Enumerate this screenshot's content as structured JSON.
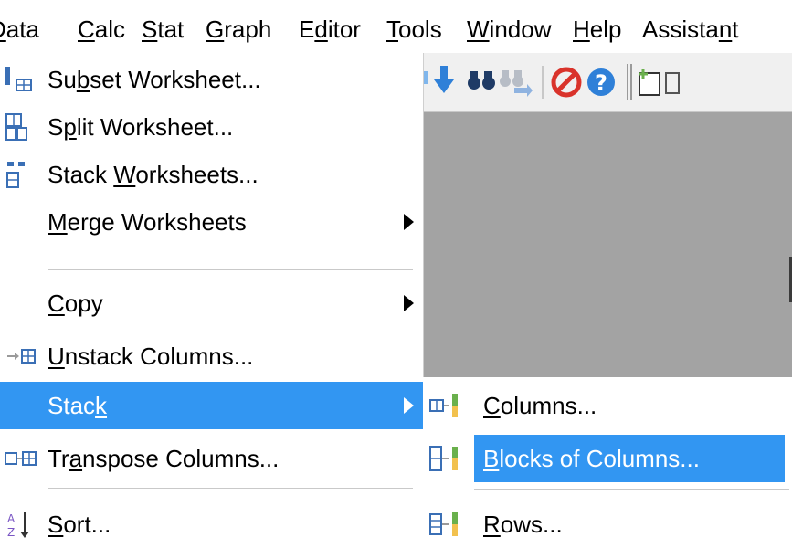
{
  "menubar": {
    "items": [
      {
        "label": "Data",
        "ul": "D"
      },
      {
        "label": "Calc",
        "ul": "C"
      },
      {
        "label": "Stat",
        "ul": "S"
      },
      {
        "label": "Graph",
        "ul": "G"
      },
      {
        "label": "Editor",
        "ul": "d"
      },
      {
        "label": "Tools",
        "ul": "T"
      },
      {
        "label": "Window",
        "ul": "W"
      },
      {
        "label": "Help",
        "ul": "H"
      },
      {
        "label": "Assistant",
        "ul": "n"
      }
    ]
  },
  "toolbar": {
    "icons": [
      "down-arrow-icon",
      "binoculars-icon",
      "find-next-icon",
      "stop-icon",
      "help-icon",
      "new-note-icon"
    ]
  },
  "data_menu": {
    "items": [
      {
        "label": "Subset Worksheet...",
        "ul": "b"
      },
      {
        "label": "Split Worksheet...",
        "ul": "p"
      },
      {
        "label": "Stack Worksheets...",
        "ul": "W"
      },
      {
        "label": "Merge Worksheets",
        "ul": "M",
        "submenu": true
      },
      {
        "label": "Copy",
        "ul": "C",
        "submenu": true
      },
      {
        "label": "Unstack Columns...",
        "ul": "U"
      },
      {
        "label": "Stack",
        "ul": "k",
        "submenu": true,
        "highlighted": true
      },
      {
        "label": "Transpose Columns...",
        "ul": "a"
      },
      {
        "label": "Sort...",
        "ul": "S"
      }
    ]
  },
  "stack_submenu": {
    "items": [
      {
        "label": "Columns...",
        "ul": "C"
      },
      {
        "label": "Blocks of Columns...",
        "ul": "B",
        "highlighted": true
      },
      {
        "label": "Rows...",
        "ul": "R"
      }
    ]
  },
  "colors": {
    "highlight": "#3296f2",
    "workspace": "#a3a3a3",
    "icon_blue": "#2f80d8",
    "icon_red": "#d9332b",
    "icon_green": "#6ab04c"
  }
}
